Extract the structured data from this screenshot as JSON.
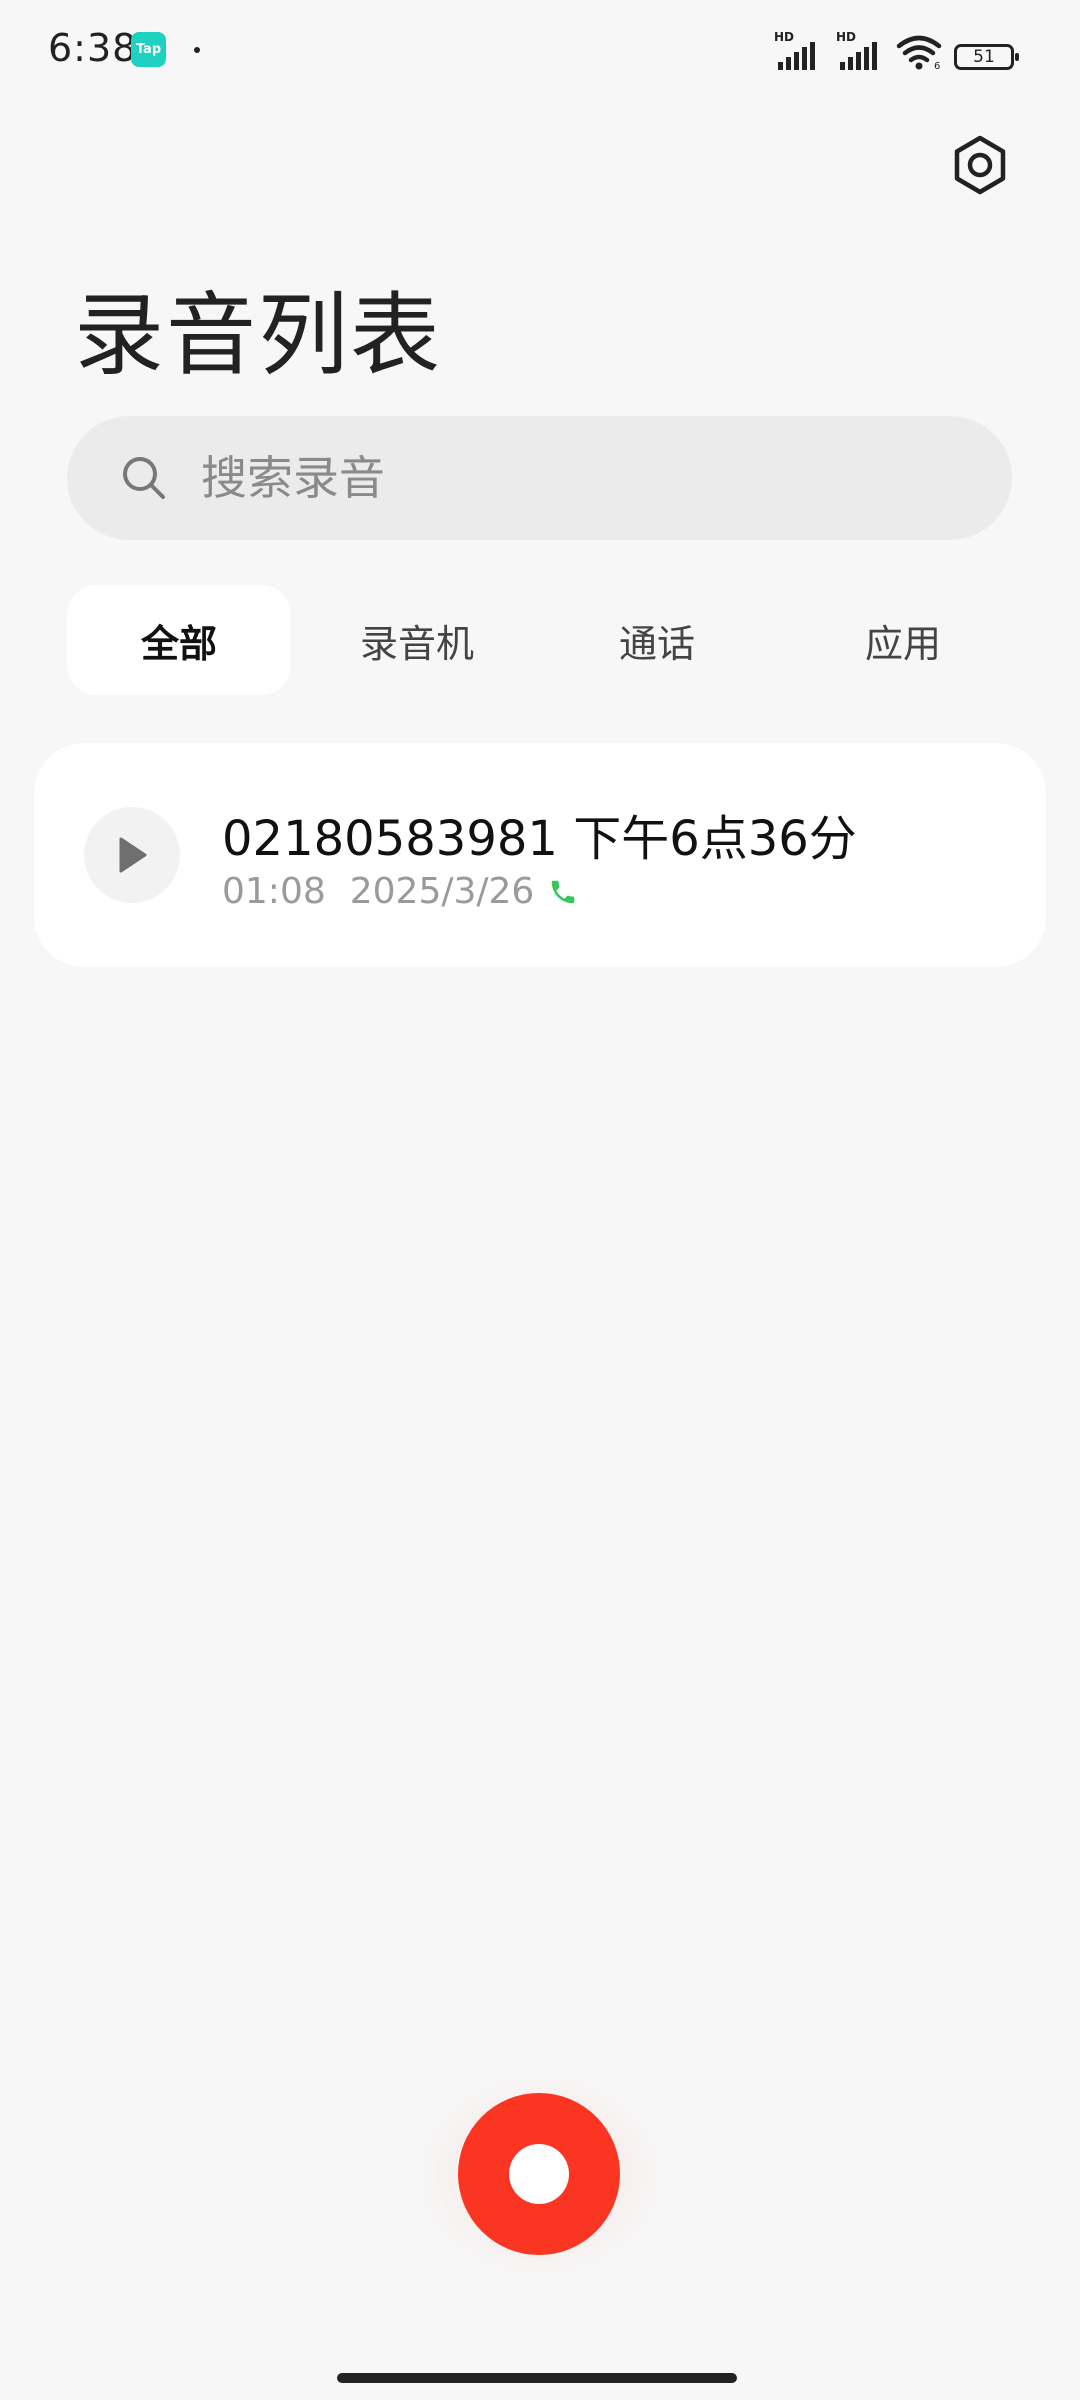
{
  "status_bar": {
    "time": "6:38",
    "app_badge": "Tap",
    "signal_1_label": "HD",
    "signal_2_label": "HD",
    "battery": "51",
    "icons": [
      "tap-app-icon",
      "signal-icon",
      "signal-icon",
      "wifi-icon",
      "battery-icon"
    ]
  },
  "header": {
    "title": "录音列表",
    "settings_icon": "settings-icon"
  },
  "search": {
    "placeholder": "搜索录音",
    "value": ""
  },
  "tabs": [
    {
      "label": "全部",
      "active": true
    },
    {
      "label": "录音机",
      "active": false
    },
    {
      "label": "通话",
      "active": false
    },
    {
      "label": "应用",
      "active": false
    }
  ],
  "recordings": [
    {
      "title": "02180583981 下午6点36分",
      "duration": "01:08",
      "date": "2025/3/26",
      "type_icon": "phone-call-icon"
    }
  ],
  "colors": {
    "record_button": "#fa3522",
    "phone_icon": "#34c759",
    "tap_badge": "#1ed1c1",
    "background": "#f7f7f7"
  }
}
